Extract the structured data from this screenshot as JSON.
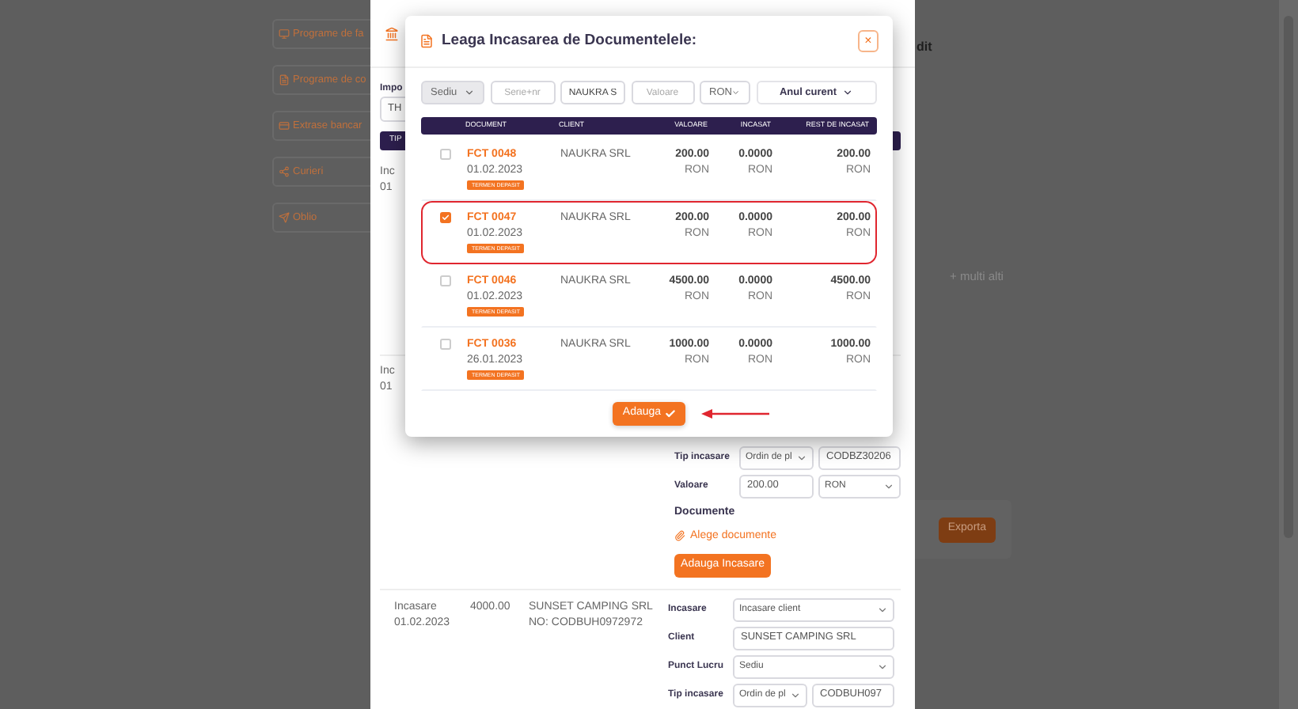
{
  "page": {
    "sidebar": [
      {
        "label": "Programe de fa"
      },
      {
        "label": "Programe de co"
      },
      {
        "label": "Extrase bancar"
      },
      {
        "label": "Curieri"
      },
      {
        "label": "Oblio"
      }
    ],
    "header_fragment": "dit",
    "more_banks": "+ multi alti",
    "export_button": "Exporta"
  },
  "back_dialog": {
    "import_label": "Impo",
    "import_value": "TH",
    "table_header": "TIP",
    "entries": [
      {
        "line_1": "Inc",
        "line_2": "01"
      },
      {
        "line_1": "Inc",
        "line_2": "01",
        "form": [
          {
            "kind": "select_input",
            "label": "Tip incasare",
            "select": "Ordin de pl",
            "input": "CODBZ30206"
          },
          {
            "kind": "input_select",
            "label": "Valoare",
            "input": "200.00",
            "select": "RON"
          }
        ],
        "documents_label": "Documente",
        "choose_link": "Alege documente",
        "add_button": "Adauga Incasare"
      },
      {
        "line_1": "Incasare",
        "line_2": "01.02.2023",
        "amount": "4000.00",
        "client": "SUNSET CAMPING SRL",
        "note": "NO: CODBUH0972972",
        "form": [
          {
            "kind": "select",
            "label": "Incasare",
            "select": "Incasare client"
          },
          {
            "kind": "input",
            "label": "Client",
            "input": "SUNSET CAMPING SRL"
          },
          {
            "kind": "select",
            "label": "Punct Lucru",
            "select": "Sediu"
          },
          {
            "kind": "select_input",
            "label": "Tip incasare",
            "select": "Ordin de pl",
            "input": "CODBUH097"
          }
        ]
      }
    ]
  },
  "modal": {
    "title": "Leaga Incasarea de Documentelele:",
    "close": "×",
    "filters": [
      {
        "kind": "select",
        "value": "Sediu",
        "disabled": true
      },
      {
        "kind": "input",
        "placeholder": "Serie+nr",
        "disabled": false
      },
      {
        "kind": "input",
        "value": "NAUKRA S",
        "disabled": false
      },
      {
        "kind": "input",
        "placeholder": "Valoare",
        "disabled": false
      },
      {
        "kind": "select",
        "value": "RON",
        "disabled": false
      },
      {
        "kind": "dropdown",
        "value": "Anul curent",
        "disabled": false
      }
    ],
    "columns": [
      "DOCUMENT",
      "CLIENT",
      "VALOARE",
      "INCASAT",
      "REST DE INCASAT"
    ],
    "rows": [
      {
        "checked": false,
        "highlighted": false,
        "number": "FCT 0048",
        "date": "01.02.2023",
        "badge": "TERMEN DEPASIT",
        "client": "NAUKRA SRL",
        "value": "200.00",
        "value_currency": "RON",
        "paid": "0.0000",
        "paid_currency": "RON",
        "rest": "200.00",
        "rest_currency": "RON"
      },
      {
        "checked": true,
        "highlighted": true,
        "number": "FCT 0047",
        "date": "01.02.2023",
        "badge": "TERMEN DEPASIT",
        "client": "NAUKRA SRL",
        "value": "200.00",
        "value_currency": "RON",
        "paid": "0.0000",
        "paid_currency": "RON",
        "rest": "200.00",
        "rest_currency": "RON"
      },
      {
        "checked": false,
        "highlighted": false,
        "number": "FCT 0046",
        "date": "01.02.2023",
        "badge": "TERMEN DEPASIT",
        "client": "NAUKRA SRL",
        "value": "4500.00",
        "value_currency": "RON",
        "paid": "0.0000",
        "paid_currency": "RON",
        "rest": "4500.00",
        "rest_currency": "RON"
      },
      {
        "checked": false,
        "highlighted": false,
        "number": "FCT 0036",
        "date": "26.01.2023",
        "badge": "TERMEN DEPASIT",
        "client": "NAUKRA SRL",
        "value": "1000.00",
        "value_currency": "RON",
        "paid": "0.0000",
        "paid_currency": "RON",
        "rest": "1000.00",
        "rest_currency": "RON"
      }
    ],
    "submit": "Adauga"
  }
}
